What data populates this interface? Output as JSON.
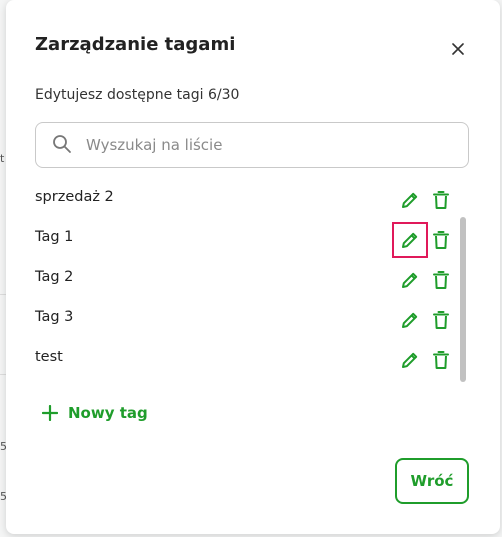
{
  "dialog": {
    "title": "Zarządzanie tagami",
    "subtitle": "Edytujesz dostępne tagi 6/30"
  },
  "search": {
    "value": "",
    "placeholder": "Wyszukaj na liście"
  },
  "tags": [
    {
      "label": "sprzedaż 2"
    },
    {
      "label": "Tag 1"
    },
    {
      "label": "Tag 2"
    },
    {
      "label": "Tag 3"
    },
    {
      "label": "test"
    }
  ],
  "add_tag_label": "Nowy tag",
  "back_label": "Wróć",
  "background": {
    "marks": [
      "t",
      "5",
      "5"
    ]
  },
  "colors": {
    "accent": "#1f9d2b",
    "highlight": "#e0195a"
  },
  "icons": {
    "close": "close-icon",
    "search": "search-icon",
    "edit": "pencil-icon",
    "delete": "trash-icon",
    "add": "plus-icon"
  }
}
